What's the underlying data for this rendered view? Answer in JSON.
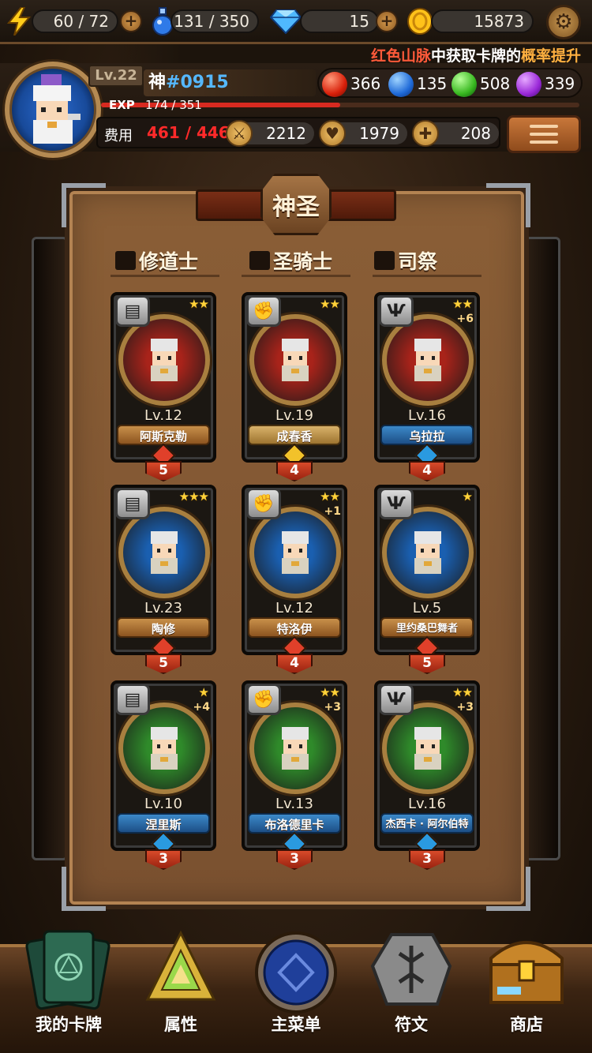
{
  "resources": {
    "energy": "60 / 72",
    "potion": "131 / 350",
    "diamond": "15",
    "gold": "15873"
  },
  "ticker": {
    "part1": "红色山脉",
    "part2": "中获取卡牌的",
    "part3": "概率提升"
  },
  "profile": {
    "level": "Lv.22",
    "name_prefix": "神",
    "id": "#0915",
    "exp_label": "EXP",
    "exp_value": "174 / 351",
    "exp_fraction": 0.5,
    "gems": {
      "red": "366",
      "blue": "135",
      "green": "508",
      "purple": "339"
    },
    "cost_label": "费用",
    "cost_value": "461 / 446",
    "attack": "2212",
    "defense": "1979",
    "heal": "208"
  },
  "panel": {
    "title": "神圣",
    "columns": [
      "修道士",
      "圣骑士",
      "司祭"
    ]
  },
  "cards": [
    {
      "level": "Lv.12",
      "name": "阿斯克勒",
      "stars": "★★",
      "plus": "",
      "cost": "5",
      "class_icon": "book-icon",
      "name_style": "gold",
      "gem": "#e0402a",
      "bg": "#a8231a"
    },
    {
      "level": "Lv.19",
      "name": "成春香",
      "stars": "★★",
      "plus": "",
      "cost": "4",
      "class_icon": "fist-icon",
      "name_style": "yellow",
      "gem": "#f2c22a",
      "bg": "#a8231a"
    },
    {
      "level": "Lv.16",
      "name": "乌拉拉",
      "stars": "★★",
      "plus": "+6",
      "cost": "4",
      "class_icon": "wings-icon",
      "name_style": "blue",
      "gem": "#2a9ae0",
      "bg": "#a8231a"
    },
    {
      "level": "Lv.23",
      "name": "陶修",
      "stars": "★★★",
      "plus": "",
      "cost": "5",
      "class_icon": "book-icon",
      "name_style": "gold",
      "gem": "#e0402a",
      "bg": "#1a5fb0"
    },
    {
      "level": "Lv.12",
      "name": "特洛伊",
      "stars": "★★",
      "plus": "+1",
      "cost": "4",
      "class_icon": "fist-icon",
      "name_style": "gold",
      "gem": "#e0402a",
      "bg": "#1a5fb0"
    },
    {
      "level": "Lv.5",
      "name": "里约桑巴舞者",
      "stars": "★",
      "plus": "",
      "cost": "5",
      "class_icon": "wings-icon",
      "name_style": "gold",
      "gem": "#e0402a",
      "bg": "#1a5fb0"
    },
    {
      "level": "Lv.10",
      "name": "涅里斯",
      "stars": "★",
      "plus": "+4",
      "cost": "3",
      "class_icon": "book-icon",
      "name_style": "blue",
      "gem": "#2a9ae0",
      "bg": "#2f8a2a"
    },
    {
      "level": "Lv.13",
      "name": "布洛德里卡",
      "stars": "★★",
      "plus": "+3",
      "cost": "3",
      "class_icon": "fist-icon",
      "name_style": "blue",
      "gem": "#2a9ae0",
      "bg": "#2f8a2a"
    },
    {
      "level": "Lv.16",
      "name": "杰西卡 · 阿尔伯特",
      "stars": "★★",
      "plus": "+3",
      "cost": "3",
      "class_icon": "wings-icon",
      "name_style": "blue",
      "gem": "#2a9ae0",
      "bg": "#2f8a2a"
    }
  ],
  "nav": [
    "我的卡牌",
    "属性",
    "主菜单",
    "符文",
    "商店"
  ]
}
